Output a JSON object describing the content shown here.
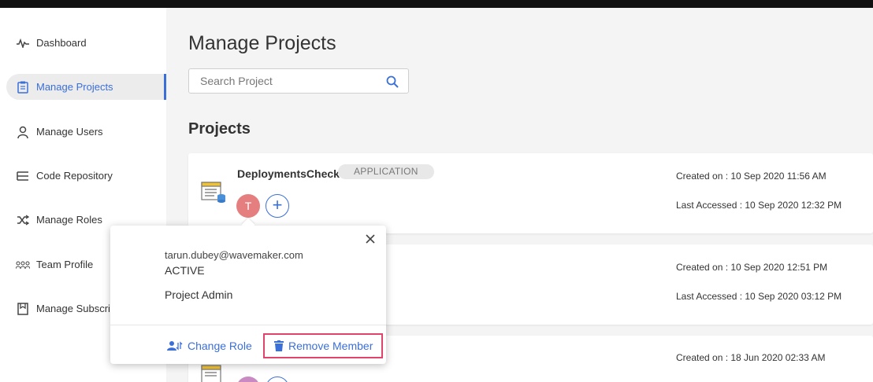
{
  "sidebar": {
    "items": [
      {
        "label": "Dashboard",
        "icon": "activity-icon"
      },
      {
        "label": "Manage Projects",
        "icon": "clipboard-icon",
        "active": true
      },
      {
        "label": "Manage Users",
        "icon": "user-icon"
      },
      {
        "label": "Code Repository",
        "icon": "database-icon"
      },
      {
        "label": "Manage Roles",
        "icon": "shuffle-icon"
      },
      {
        "label": "Team Profile",
        "icon": "team-icon"
      },
      {
        "label": "Manage Subscri",
        "icon": "bookmark-icon"
      }
    ]
  },
  "main": {
    "title": "Manage Projects",
    "search": {
      "placeholder": "Search Project",
      "value": ""
    },
    "section_title": "Projects"
  },
  "projects": [
    {
      "name": "DeploymentsCheck",
      "type": "APPLICATION",
      "member_initial": "T",
      "add_symbol": "+",
      "created": "Created on : 10 Sep 2020 11:56 AM",
      "last_accessed": "Last Accessed : 10 Sep 2020 12:32 PM"
    },
    {
      "created": "Created on : 10 Sep 2020 12:51 PM",
      "last_accessed": "Last Accessed : 10 Sep 2020 03:12 PM"
    },
    {
      "created": "Created on : 18 Jun 2020 02:33 AM"
    }
  ],
  "popover": {
    "email": "tarun.dubey@wavemaker.com",
    "status": "ACTIVE",
    "role": "Project Admin",
    "change_role_label": "Change Role",
    "remove_member_label": "Remove Member"
  },
  "colors": {
    "accent": "#3b6fd8",
    "avatar": "#e57f7f",
    "highlight": "#e0446a"
  }
}
